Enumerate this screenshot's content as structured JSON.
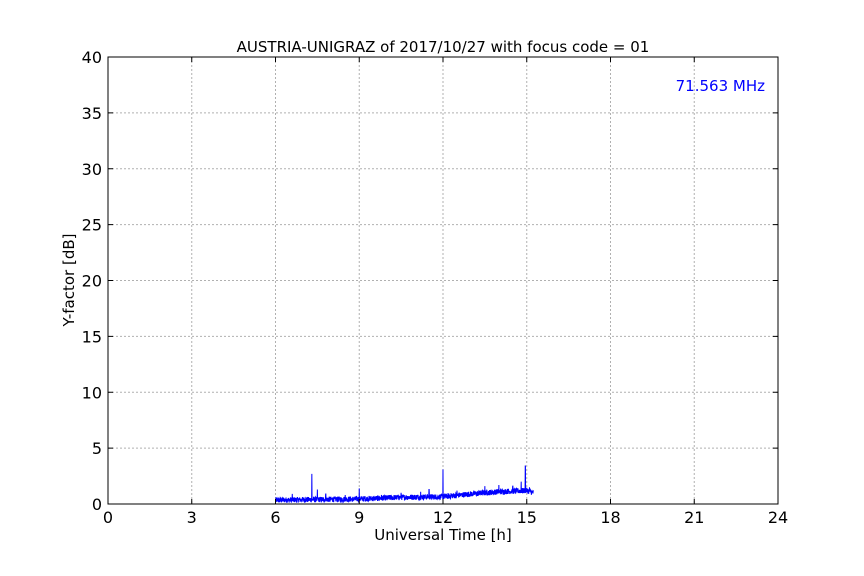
{
  "chart_data": {
    "type": "line",
    "title": "AUSTRIA-UNIGRAZ of 2017/10/27 with focus code = 01",
    "xlabel": "Universal Time [h]",
    "ylabel": "Y-factor [dB]",
    "xlim": [
      0,
      24
    ],
    "ylim": [
      0,
      40
    ],
    "xticks": [
      0,
      3,
      6,
      9,
      12,
      15,
      18,
      21,
      24
    ],
    "yticks": [
      0,
      5,
      10,
      15,
      20,
      25,
      30,
      35,
      40
    ],
    "grid": true,
    "annotation": {
      "text": "71.563 MHz",
      "position": "top-right",
      "color": "#0000ff"
    },
    "series": [
      {
        "color": "#0000ff",
        "start": 6.0,
        "end": 15.25,
        "baseline": [
          [
            6.0,
            0.35
          ],
          [
            7.5,
            0.4
          ],
          [
            9.0,
            0.45
          ],
          [
            10.5,
            0.6
          ],
          [
            12.0,
            0.65
          ],
          [
            13.0,
            0.9
          ],
          [
            14.0,
            1.1
          ],
          [
            15.0,
            1.2
          ],
          [
            15.25,
            1.0
          ]
        ],
        "noise_amplitude": 0.5,
        "spikes": [
          [
            6.6,
            0.9
          ],
          [
            7.3,
            2.7
          ],
          [
            7.5,
            1.3
          ],
          [
            7.8,
            0.9
          ],
          [
            8.5,
            0.8
          ],
          [
            9.0,
            1.4
          ],
          [
            9.8,
            0.8
          ],
          [
            10.5,
            1.0
          ],
          [
            11.2,
            1.1
          ],
          [
            11.5,
            1.3
          ],
          [
            12.0,
            3.1
          ],
          [
            12.5,
            1.2
          ],
          [
            13.5,
            1.6
          ],
          [
            14.0,
            1.7
          ],
          [
            14.5,
            1.6
          ],
          [
            14.8,
            2.0
          ],
          [
            14.95,
            3.4
          ],
          [
            15.1,
            1.5
          ]
        ]
      }
    ]
  }
}
